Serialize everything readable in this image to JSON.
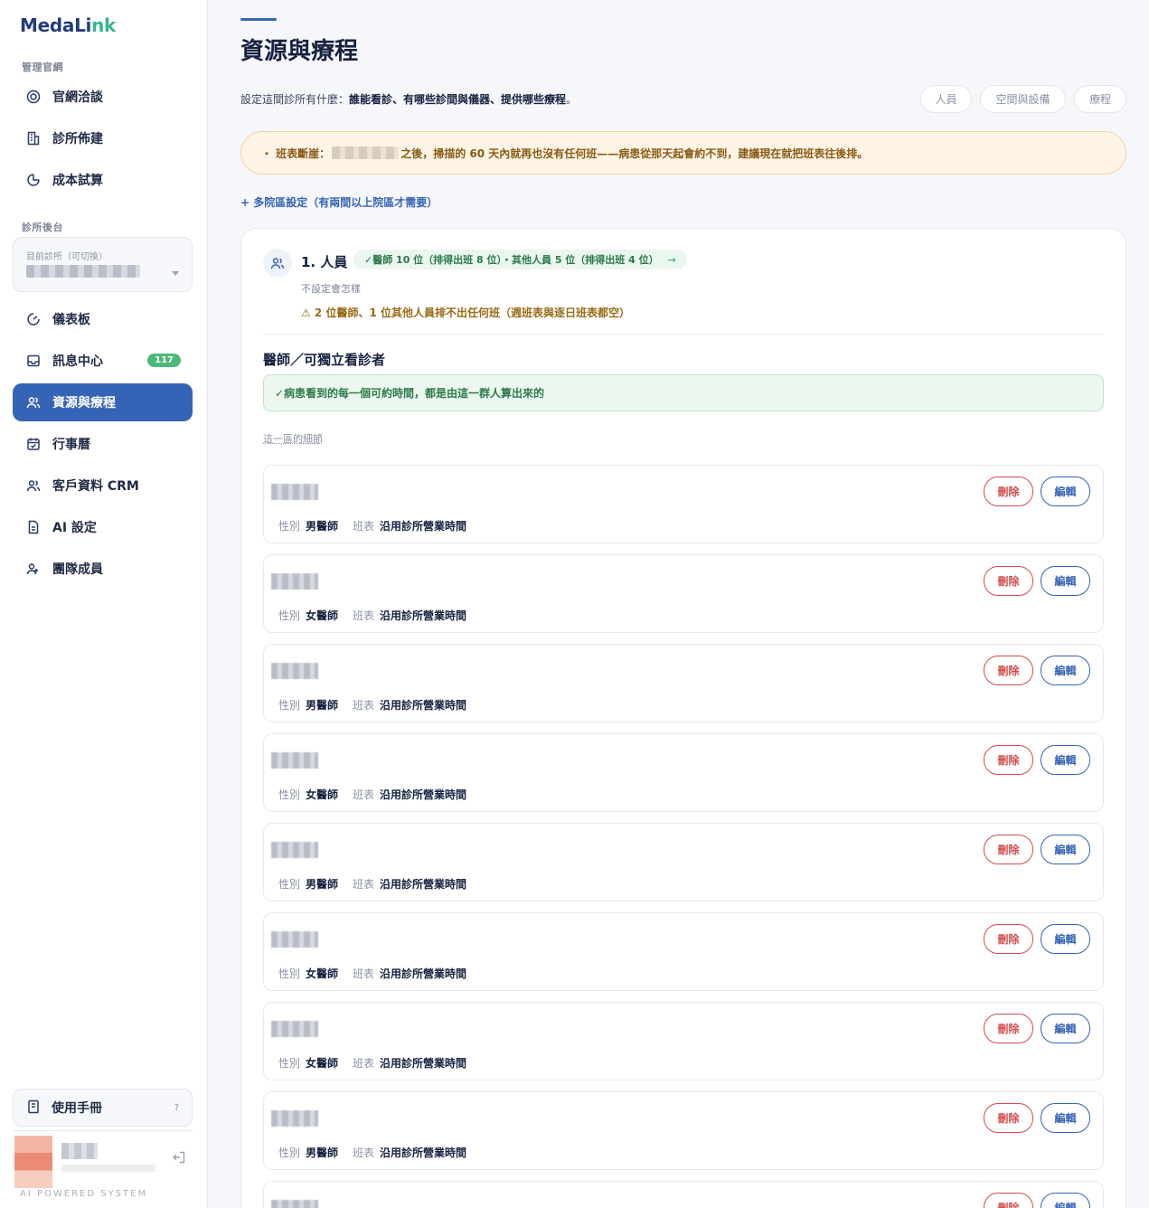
{
  "sidebar": {
    "logo_a": "MedaLi",
    "logo_b": "nk",
    "section_admin": "管理官網",
    "admin_items": [
      {
        "label": "官網洽談",
        "icon": "target-icon"
      },
      {
        "label": "診所佈建",
        "icon": "building-icon"
      },
      {
        "label": "成本試算",
        "icon": "pie-chart-icon"
      }
    ],
    "section_clinic": "診所後台",
    "clinic_select_label": "目前診所（可切換）",
    "clinic_items": [
      {
        "label": "儀表板",
        "icon": "dashboard-icon"
      },
      {
        "label": "訊息中心",
        "icon": "inbox-icon",
        "badge": "117"
      },
      {
        "label": "資源與療程",
        "icon": "users-icon",
        "active": true
      },
      {
        "label": "行事曆",
        "icon": "calendar-icon"
      },
      {
        "label": "客戶資料 CRM",
        "icon": "users-icon"
      },
      {
        "label": "AI 設定",
        "icon": "document-icon"
      },
      {
        "label": "團隊成員",
        "icon": "team-icon"
      }
    ],
    "manual_label": "使用手冊",
    "manual_hint": "?",
    "powered_by": "AI POWERED SYSTEM"
  },
  "header": {
    "title": "資源與療程",
    "desc_prefix": "設定這間診所有什麼：",
    "desc_bold": "誰能看診、有哪些診間與儀器、提供哪些療程",
    "desc_suffix": "。",
    "chips": [
      "人員",
      "空間與設備",
      "療程"
    ]
  },
  "warning": {
    "prefix": "・ 班表斷崖：",
    "suffix": "之後，掃描的 60 天內就再也沒有任何班——病患從那天起會約不到，建議現在就把班表往後排。"
  },
  "multi_site_link": "+ 多院區設定（有兩間以上院區才需要）",
  "staff_section": {
    "title": "1. 人員",
    "summary": "✓醫師 10 位（排得出班 8 位）・其他人員 5 位（排得出班 4 位）",
    "summary_arrow": "→",
    "hint_label": "不設定會怎樣",
    "hint_warn": "⚠ 2 位醫師、1 位其他人員排不出任何班（週班表與逐日班表都空）",
    "sub_title": "醫師／可獨立看診者",
    "ok_text": "✓病患看到的每一個可約時間，都是由這一群人算出來的",
    "detail_label": "這一區的細節",
    "gender_key": "性別",
    "schedule_key": "班表",
    "delete_label": "刪除",
    "edit_label": "編輯",
    "rows": [
      {
        "gender": "男醫師",
        "schedule": "沿用診所營業時間"
      },
      {
        "gender": "女醫師",
        "schedule": "沿用診所營業時間"
      },
      {
        "gender": "男醫師",
        "schedule": "沿用診所營業時間"
      },
      {
        "gender": "女醫師",
        "schedule": "沿用診所營業時間"
      },
      {
        "gender": "男醫師",
        "schedule": "沿用診所營業時間"
      },
      {
        "gender": "女醫師",
        "schedule": "沿用診所營業時間"
      },
      {
        "gender": "女醫師",
        "schedule": "沿用診所營業時間"
      },
      {
        "gender": "男醫師",
        "schedule": "沿用診所營業時間"
      },
      {
        "gender": "",
        "schedule": ""
      }
    ]
  },
  "colors": {
    "accent": "#3563b5",
    "brand_green": "#3bb48c",
    "danger": "#d24b4b",
    "success": "#4cb97b",
    "warning": "#f3d29c"
  }
}
